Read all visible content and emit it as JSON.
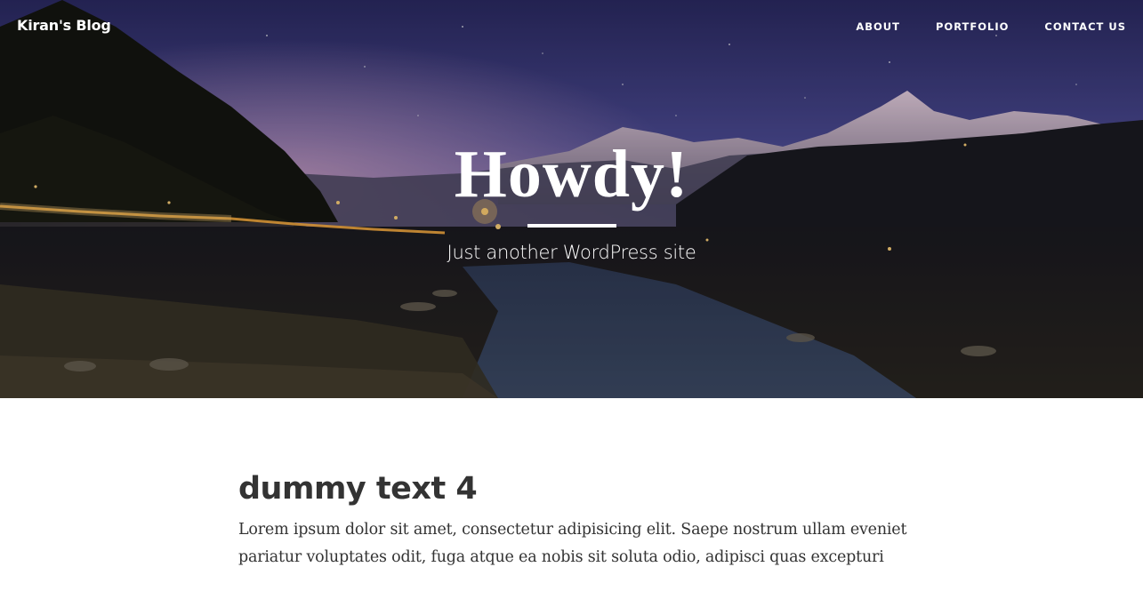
{
  "navbar": {
    "brand": "Kiran's Blog",
    "links": [
      {
        "label": "ABOUT"
      },
      {
        "label": "PORTFOLIO"
      },
      {
        "label": "CONTACT US"
      }
    ]
  },
  "hero": {
    "title": "Howdy!",
    "tagline": "Just another WordPress site",
    "background_image": "night-river-valley-with-snowy-mountains"
  },
  "post": {
    "title": "dummy text 4",
    "excerpt": "Lorem ipsum dolor sit amet, consectetur adipisicing elit. Saepe nostrum ullam eveniet pariatur voluptates odit, fuga atque ea nobis sit soluta odio, adipisci quas excepturi"
  },
  "colors": {
    "text_dark": "#333333",
    "hero_overlay_text": "#ffffff",
    "page_background": "#ffffff"
  }
}
